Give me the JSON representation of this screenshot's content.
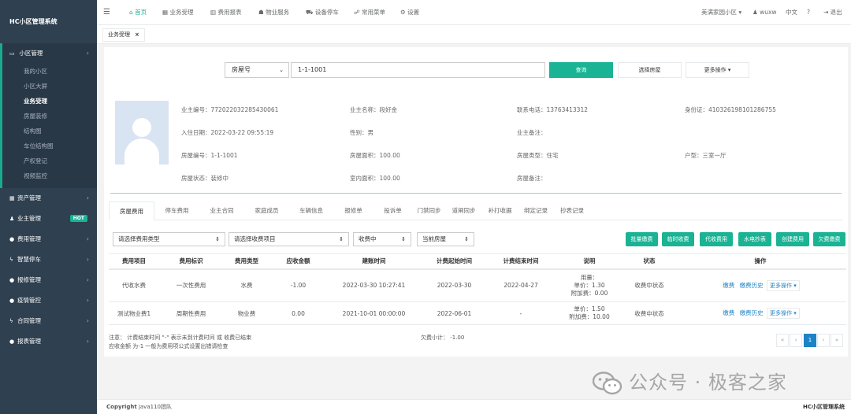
{
  "app": {
    "title": "HC小区管理系统"
  },
  "sidebar": {
    "groups": [
      {
        "label": "小区管理",
        "icon": "monitor-icon"
      },
      {
        "label": "资产管理",
        "icon": "grid-icon"
      },
      {
        "label": "业主管理",
        "icon": "user-icon",
        "badge": "HOT"
      },
      {
        "label": "费用管理",
        "icon": "circle-icon"
      },
      {
        "label": "智慧停车",
        "icon": "bolt-icon"
      },
      {
        "label": "报修管理",
        "icon": "circle-icon"
      },
      {
        "label": "疫情管控",
        "icon": "circle-icon"
      },
      {
        "label": "合同管理",
        "icon": "bolt-icon"
      },
      {
        "label": "报表管理",
        "icon": "circle-icon"
      }
    ],
    "sub_items": [
      "我的小区",
      "小区大屏",
      "业务受理",
      "房屋装修",
      "结构图",
      "车位结构图",
      "产权登记",
      "视频监控"
    ]
  },
  "topnav": {
    "items": [
      "首页",
      "业务受理",
      "费用报表",
      "物业服务",
      "设备停车",
      "常用菜单",
      "设置"
    ],
    "community": "美满家园小区",
    "user": "wuxw",
    "lang": "中文",
    "help": "?",
    "logout": "退出"
  },
  "pagetab": {
    "label": "业务受理"
  },
  "search": {
    "type": "房屋号",
    "value": "1-1-1001",
    "query_btn": "查询",
    "select_btn": "选择房屋",
    "more_btn": "更多操作"
  },
  "owner": {
    "id_label": "业主编号：",
    "id": "772022032285430061",
    "name_label": "业主名称：",
    "name": "段好金",
    "phone_label": "联系电话：",
    "phone": "13763413312",
    "idcard_label": "身份证：",
    "idcard": "410326198101286755",
    "checkin_label": "入住日期：",
    "checkin": "2022-03-22 09:55:19",
    "sex_label": "性别：",
    "sex": "男",
    "remark_label": "业主备注：",
    "remark": "",
    "room_label": "房屋编号：",
    "room": "1-1-1001",
    "area_label": "房屋面积：",
    "area": "100.00",
    "roomtype_label": "房屋类型：",
    "roomtype": "住宅",
    "layout_label": "户型：",
    "layout": "三室一厅",
    "status_label": "房屋状态：",
    "status": "装修中",
    "inner_label": "室内面积：",
    "inner": "100.00",
    "roomremark_label": "房屋备注：",
    "roomremark": ""
  },
  "tabs": [
    "房屋费用",
    "停车费用",
    "业主合同",
    "家庭成员",
    "车辆信息",
    "报修单",
    "投诉单",
    "门禁同步",
    "道闸同步",
    "补打收据",
    "绑定记录",
    "抄表记录"
  ],
  "filters": {
    "fee_type": "请选择费用类型",
    "fee_item": "请选择收费项目",
    "state": "收费中",
    "scope": "当前房屋"
  },
  "actions": [
    "批量缴费",
    "临时收费",
    "代收费用",
    "水电抄表",
    "创建费用",
    "欠费缴费"
  ],
  "table": {
    "headers": [
      "费用项目",
      "费用标识",
      "费用类型",
      "应收金额",
      "建账时间",
      "计费起始时间",
      "计费结束时间",
      "说明",
      "状态",
      "操作"
    ],
    "rows": [
      {
        "item": "代收水费",
        "flag": "一次性费用",
        "type": "水费",
        "amount": "-1.00",
        "created": "2022-03-30 10:27:41",
        "start": "2022-03-30",
        "end": "2022-04-27",
        "desc1": "用量：",
        "desc2": "单价：1.30",
        "desc3": "附加费：0.00",
        "state": "收费中状态"
      },
      {
        "item": "测试物业费1",
        "flag": "周期性费用",
        "type": "物业费",
        "amount": "0.00",
        "created": "2021-10-01 00:00:00",
        "start": "2022-06-01",
        "end": "-",
        "desc1": "单价：1.50",
        "desc2": "附加费：10.00",
        "desc3": "",
        "state": "收费中状态"
      }
    ],
    "op_pay": "缴费",
    "op_history": "缴费历史",
    "op_more": "更多操作"
  },
  "notes": {
    "line1": "注意：  计费结束时间  \"-\"  表示未到计费时间 或 收费已结束",
    "line2": "应收金额 为-1 一般为费用项公式设置出错请检查",
    "owed": "欠费小计：  -1.00"
  },
  "pager": [
    "«",
    "‹",
    "1",
    "›",
    "»"
  ],
  "footer": {
    "copyright_bold": "Copyright",
    "copyright": " java110团队",
    "right": "HC小区管理系统"
  },
  "watermark": {
    "text": "公众号 · 极客之家"
  }
}
